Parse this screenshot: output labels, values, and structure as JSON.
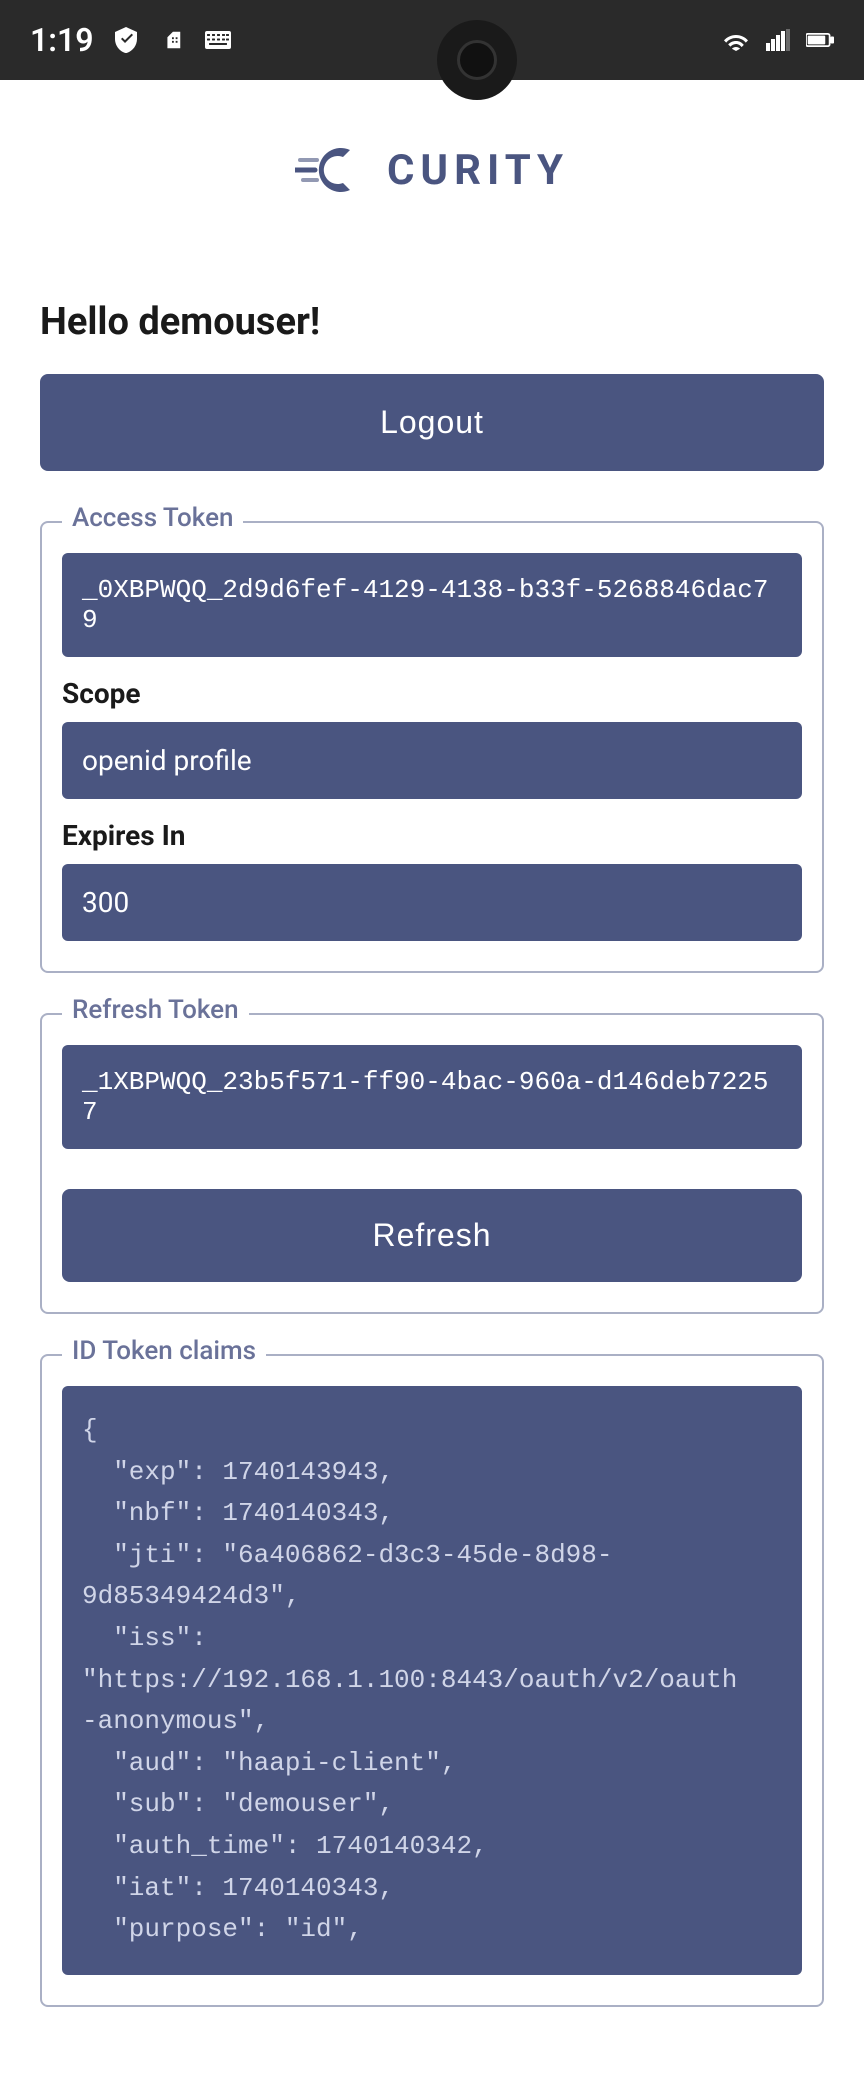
{
  "statusBar": {
    "time": "1:19",
    "icons": [
      "shield",
      "sim",
      "keyboard"
    ]
  },
  "logo": {
    "text": "CURITY"
  },
  "greeting": "Hello demouser!",
  "buttons": {
    "logout": "Logout",
    "refresh": "Refresh"
  },
  "accessToken": {
    "legend": "Access Token",
    "value": "_0XBPWQQ_2d9d6fef-4129-4138-b33f-5268846dac79",
    "scopeLabel": "Scope",
    "scopeValue": "openid profile",
    "expiresLabel": "Expires In",
    "expiresValue": "300"
  },
  "refreshToken": {
    "legend": "Refresh Token",
    "value": "_1XBPWQQ_23b5f571-ff90-4bac-960a-d146deb72257"
  },
  "idTokenClaims": {
    "legend": "ID Token claims",
    "json": "{\n  \"exp\": 1740143943,\n  \"nbf\": 1740140343,\n  \"jti\": \"6a406862-d3c3-45de-8d98-9d85349424d3\",\n  \"iss\": \"https://192.168.1.100:8443/oauth/v2/oauth-anonymous\",\n  \"aud\": \"haapi-client\",\n  \"sub\": \"demouser\",\n  \"auth_time\": 1740140342,\n  \"iat\": 1740140343,\n  \"purpose\": \"id\","
  }
}
